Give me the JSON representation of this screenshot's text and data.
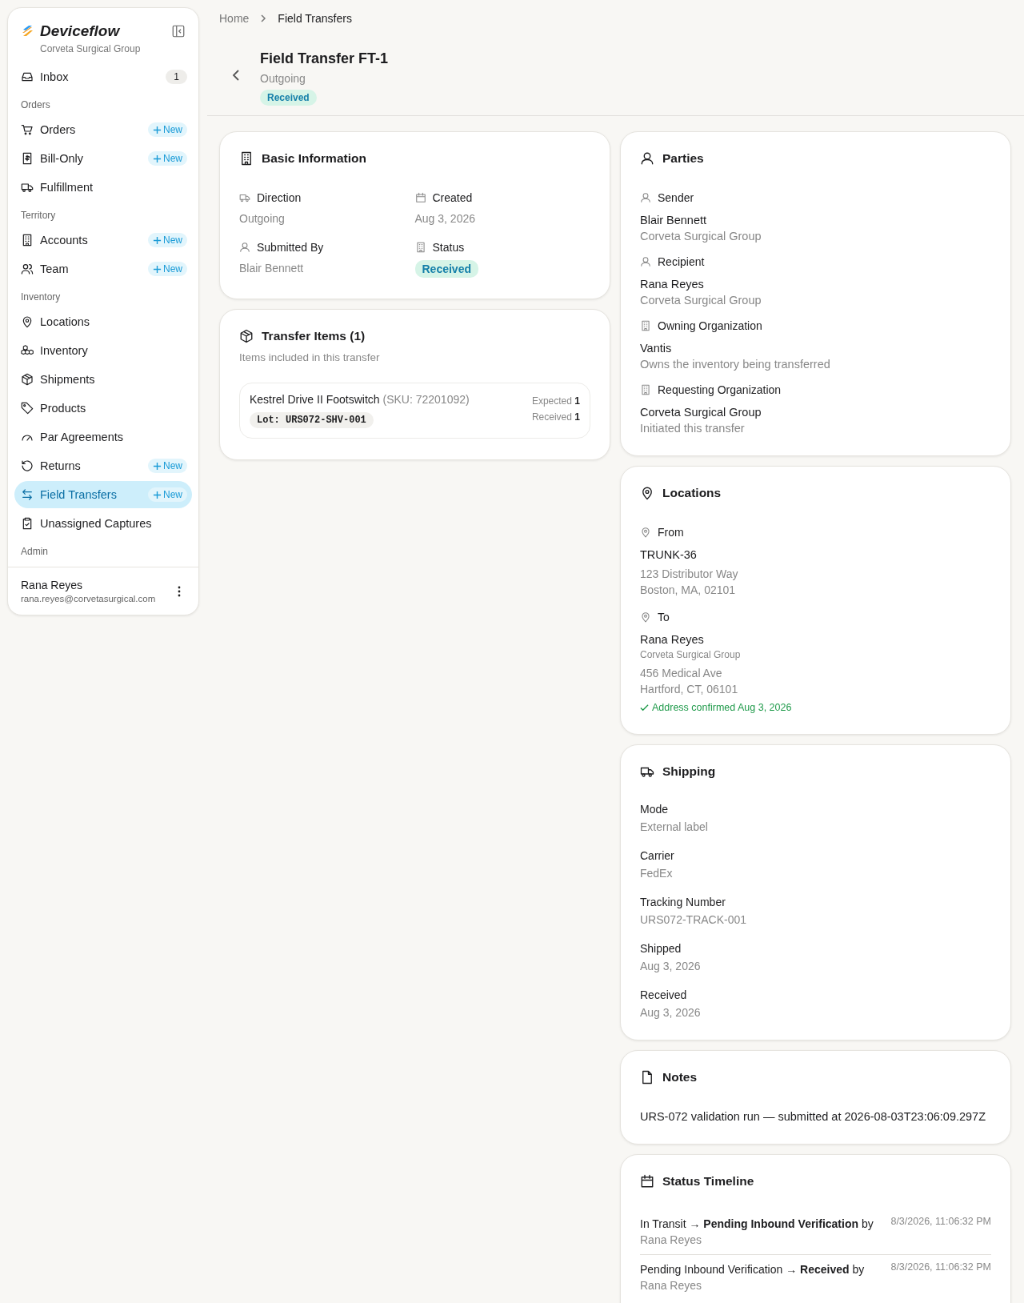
{
  "brand": {
    "name": "Deviceflow",
    "org": "Corveta Surgical Group"
  },
  "sidebar": {
    "groups": [
      {
        "items": [
          {
            "label": "Inbox",
            "badge": "1",
            "selected": false
          }
        ]
      },
      {
        "title": "Orders",
        "items": [
          {
            "label": "Orders",
            "new": "New",
            "selected": false
          },
          {
            "label": "Bill-Only",
            "new": "New",
            "selected": false
          },
          {
            "label": "Fulfillment",
            "selected": false
          }
        ]
      },
      {
        "title": "Territory",
        "items": [
          {
            "label": "Accounts",
            "new": "New",
            "selected": false
          },
          {
            "label": "Team",
            "new": "New",
            "selected": false
          }
        ]
      },
      {
        "title": "Inventory",
        "items": [
          {
            "label": "Locations",
            "selected": false
          },
          {
            "label": "Inventory",
            "selected": false
          },
          {
            "label": "Shipments",
            "selected": false
          },
          {
            "label": "Products",
            "selected": false
          },
          {
            "label": "Par Agreements",
            "selected": false
          },
          {
            "label": "Returns",
            "new": "New",
            "selected": false
          },
          {
            "label": "Field Transfers",
            "new": "New",
            "selected": true
          },
          {
            "label": "Unassigned Captures",
            "selected": false
          }
        ]
      },
      {
        "title": "Admin"
      }
    ]
  },
  "user": {
    "name": "Rana Reyes",
    "email": "rana.reyes@corvetasurgical.com"
  },
  "breadcrumb": [
    "Home",
    "Field Transfers"
  ],
  "header": {
    "title": "Field Transfer FT-1",
    "subtitle": "Outgoing",
    "status": "Received"
  },
  "basic_info": {
    "title": "Basic Information",
    "fields": [
      {
        "label": "Direction",
        "kind": "text",
        "value": "Outgoing"
      },
      {
        "label": "Created",
        "kind": "text",
        "value": "Aug 3, 2026"
      },
      {
        "label": "Submitted By",
        "kind": "text",
        "value": "Blair Bennett"
      },
      {
        "label": "Status",
        "kind": "badge",
        "value": "Received"
      }
    ]
  },
  "transfer_items": {
    "title": "Transfer Items (1)",
    "subtitle": "Items included in this transfer",
    "items": [
      {
        "name": "Kestrel Drive II Footswitch",
        "sku": "(SKU: 72201092)",
        "lot": "Lot: URS072-SHV-001",
        "expected_label": "Expected",
        "expected": "1",
        "received_label": "Received",
        "received": "1"
      }
    ]
  },
  "parties": {
    "title": "Parties",
    "entries": [
      {
        "label": "Sender",
        "name": "Blair Bennett",
        "note": "Corveta Surgical Group"
      },
      {
        "label": "Recipient",
        "name": "Rana Reyes",
        "note": "Corveta Surgical Group"
      },
      {
        "label": "Owning Organization",
        "name": "Vantis",
        "note": "Owns the inventory being transferred"
      },
      {
        "label": "Requesting Organization",
        "name": "Corveta Surgical Group",
        "note": "Initiated this transfer"
      }
    ]
  },
  "locations": {
    "title": "Locations",
    "entries": [
      {
        "label": "From",
        "name": "TRUNK-36",
        "lines": [
          "123 Distributor Way",
          "Boston, MA, 02101"
        ]
      },
      {
        "label": "To",
        "name": "Rana Reyes",
        "org": "Corveta Surgical Group",
        "lines": [
          "456 Medical Ave",
          "Hartford, CT, 06101"
        ],
        "confirmation": "Address confirmed Aug 3, 2026"
      }
    ]
  },
  "shipping": {
    "title": "Shipping",
    "fields": [
      {
        "label": "Mode",
        "value": "External label"
      },
      {
        "label": "Carrier",
        "value": "FedEx"
      },
      {
        "label": "Tracking Number",
        "value": "URS072-TRACK-001"
      },
      {
        "label": "Shipped",
        "value": "Aug 3, 2026"
      },
      {
        "label": "Received",
        "value": "Aug 3, 2026"
      }
    ]
  },
  "notes": {
    "title": "Notes",
    "text": "URS-072 validation run — submitted at 2026-08-03T23:06:09.297Z"
  },
  "timeline": {
    "title": "Status Timeline",
    "events": [
      {
        "change": "In Transit → **Pending Inbound Verification** by",
        "actor": "Rana Reyes",
        "time": "8/3/2026, 11:06:32 PM"
      },
      {
        "change": "Pending Inbound Verification → **Received** by",
        "actor": "Rana Reyes",
        "time": "8/3/2026, 11:06:32 PM"
      }
    ]
  }
}
